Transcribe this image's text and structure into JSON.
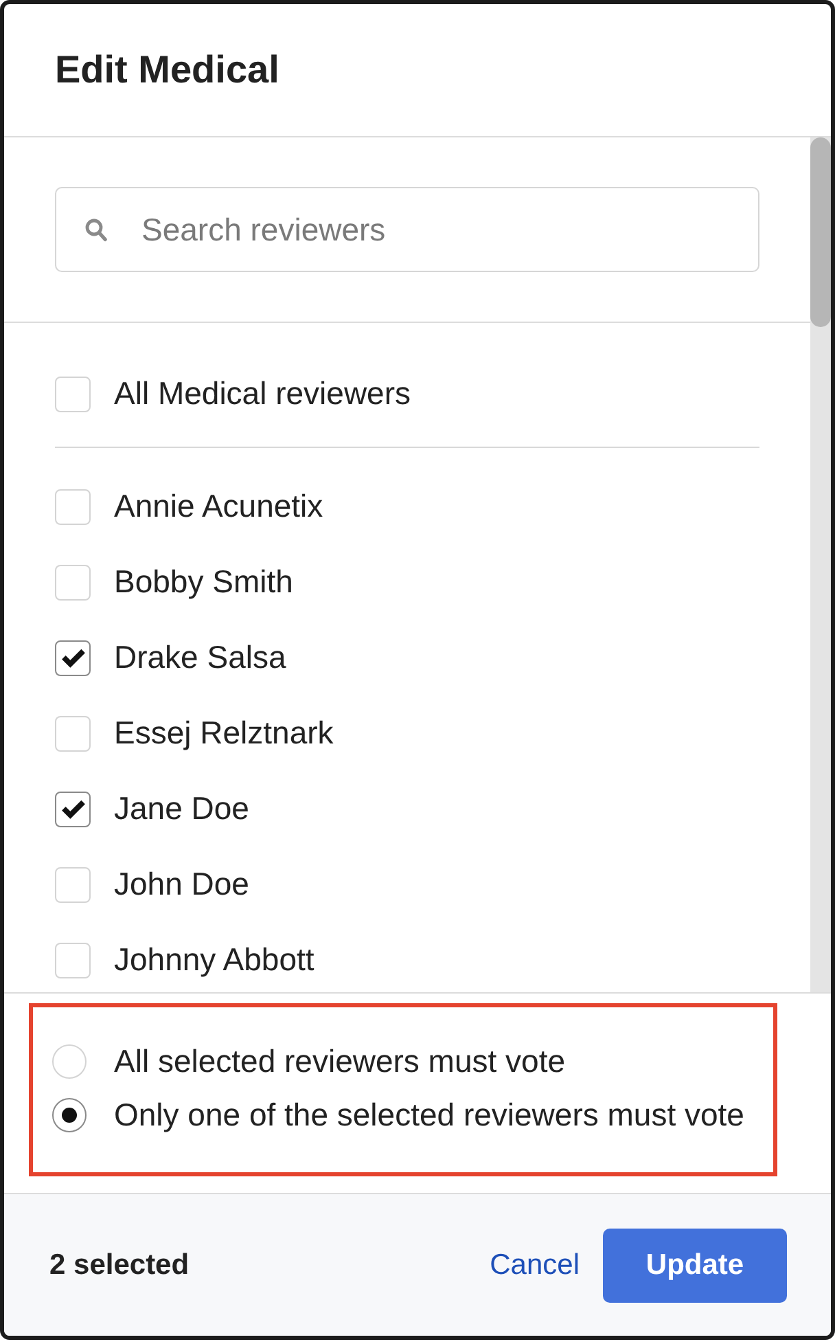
{
  "dialog": {
    "title": "Edit Medical"
  },
  "search": {
    "placeholder": "Search reviewers"
  },
  "select_all": {
    "label": "All Medical reviewers",
    "checked": false
  },
  "reviewers": [
    {
      "name": "Annie Acunetix",
      "checked": false
    },
    {
      "name": "Bobby Smith",
      "checked": false
    },
    {
      "name": "Drake Salsa",
      "checked": true
    },
    {
      "name": "Essej Relztnark",
      "checked": false
    },
    {
      "name": "Jane Doe",
      "checked": true
    },
    {
      "name": "John Doe",
      "checked": false
    },
    {
      "name": "Johnny Abbott",
      "checked": false
    }
  ],
  "vote_rule": {
    "highlighted": true,
    "options": [
      {
        "label": "All selected reviewers must vote",
        "selected": false
      },
      {
        "label": "Only one of the selected reviewers must vote",
        "selected": true
      }
    ]
  },
  "footer": {
    "count": "2 selected",
    "buttons": [
      {
        "label": "Cancel",
        "kind": "link"
      },
      {
        "label": "Update",
        "kind": "primary"
      }
    ]
  }
}
